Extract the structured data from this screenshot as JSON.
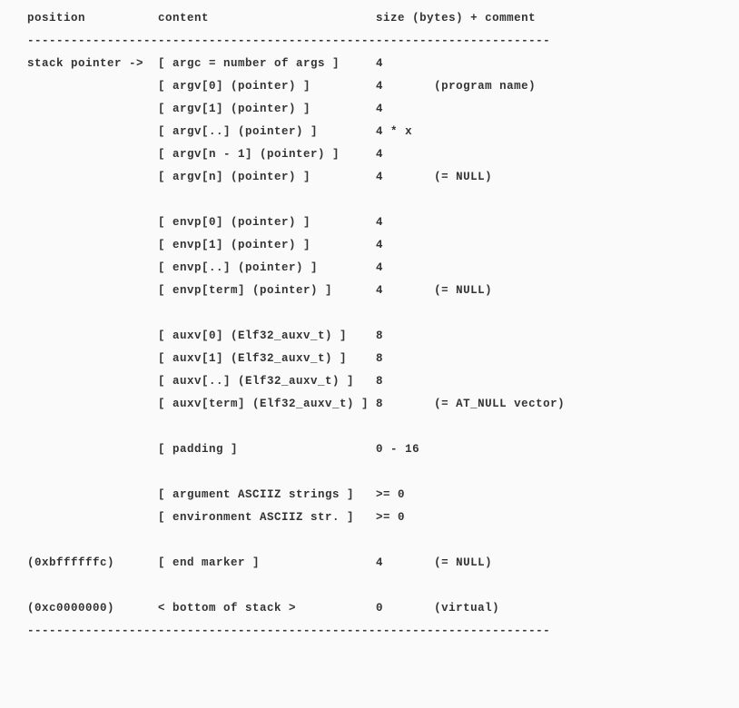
{
  "header": {
    "position": "position",
    "content": "content",
    "size_comment": "size (bytes) + comment"
  },
  "divider": "------------------------------------------------------------------------",
  "rows": [
    {
      "position": "stack pointer ->",
      "content": "[ argc = number of args ]",
      "size": "4",
      "comment": ""
    },
    {
      "position": "",
      "content": "[ argv[0] (pointer) ]",
      "size": "4",
      "comment": "(program name)"
    },
    {
      "position": "",
      "content": "[ argv[1] (pointer) ]",
      "size": "4",
      "comment": ""
    },
    {
      "position": "",
      "content": "[ argv[..] (pointer) ]",
      "size": "4 * x",
      "comment": ""
    },
    {
      "position": "",
      "content": "[ argv[n - 1] (pointer) ]",
      "size": "4",
      "comment": ""
    },
    {
      "position": "",
      "content": "[ argv[n] (pointer) ]",
      "size": "4",
      "comment": "(= NULL)"
    },
    {
      "blank": true
    },
    {
      "position": "",
      "content": "[ envp[0] (pointer) ]",
      "size": "4",
      "comment": ""
    },
    {
      "position": "",
      "content": "[ envp[1] (pointer) ]",
      "size": "4",
      "comment": ""
    },
    {
      "position": "",
      "content": "[ envp[..] (pointer) ]",
      "size": "4",
      "comment": ""
    },
    {
      "position": "",
      "content": "[ envp[term] (pointer) ]",
      "size": "4",
      "comment": "(= NULL)"
    },
    {
      "blank": true
    },
    {
      "position": "",
      "content": "[ auxv[0] (Elf32_auxv_t) ]",
      "size": "8",
      "comment": ""
    },
    {
      "position": "",
      "content": "[ auxv[1] (Elf32_auxv_t) ]",
      "size": "8",
      "comment": ""
    },
    {
      "position": "",
      "content": "[ auxv[..] (Elf32_auxv_t) ]",
      "size": "8",
      "comment": ""
    },
    {
      "position": "",
      "content": "[ auxv[term] (Elf32_auxv_t) ]",
      "size": "8",
      "comment": "(= AT_NULL vector)"
    },
    {
      "blank": true
    },
    {
      "position": "",
      "content": "[ padding ]",
      "size": "0 - 16",
      "comment": ""
    },
    {
      "blank": true
    },
    {
      "position": "",
      "content": "[ argument ASCIIZ strings ]",
      "size": ">= 0",
      "comment": ""
    },
    {
      "position": "",
      "content": "[ environment ASCIIZ str. ]",
      "size": ">= 0",
      "comment": ""
    },
    {
      "blank": true
    },
    {
      "position": "(0xbffffffc)",
      "content": "[ end marker ]",
      "size": "4",
      "comment": "(= NULL)"
    },
    {
      "blank": true
    },
    {
      "position": "(0xc0000000)",
      "content": "< bottom of stack >",
      "size": "0",
      "comment": "(virtual)"
    }
  ],
  "col_widths": {
    "position": 18,
    "content": 30,
    "size": 8
  }
}
